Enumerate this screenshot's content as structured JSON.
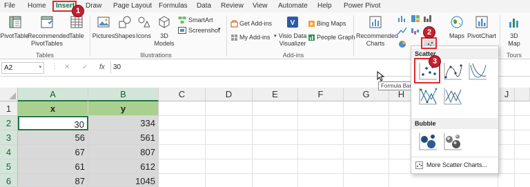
{
  "menu": {
    "items": [
      "File",
      "Home",
      "Insert",
      "Draw",
      "Page Layout",
      "Formulas",
      "Data",
      "Review",
      "View",
      "Automate",
      "Help",
      "Power Pivot"
    ],
    "active": "Insert"
  },
  "ribbon": {
    "tables": {
      "pivottable": "PivotTable",
      "recommended_line1": "Recommended",
      "recommended_line2": "PivotTables",
      "table": "Table",
      "group": "Tables"
    },
    "illustrations": {
      "pictures": "Pictures",
      "shapes": "Shapes",
      "icons": "Icons",
      "models_line1": "3D",
      "models_line2": "Models",
      "smartart": "SmartArt",
      "screenshot": "Screenshot",
      "group": "Illustrations"
    },
    "addins": {
      "get_addins": "Get Add-ins",
      "my_addins": "My Add-ins",
      "visio_line1": "Visio Data",
      "visio_line2": "Visualizer",
      "bing_maps": "Bing Maps",
      "people_graph": "People Graph",
      "group": "Add-ins"
    },
    "charts": {
      "recommended_line1": "Recommended",
      "recommended_line2": "Charts",
      "maps": "Maps",
      "pivotchart": "PivotChart"
    },
    "tours": {
      "map_line1": "3D",
      "map_line2": "Map",
      "group": "Tours"
    }
  },
  "formula_bar": {
    "name_box": "A2",
    "cancel": "✕",
    "enter": "✓",
    "fx": "fx",
    "value": "30"
  },
  "tooltip": "Formula Bar",
  "grid": {
    "columns": [
      "A",
      "B",
      "C",
      "D",
      "E",
      "F",
      "G",
      "H",
      "I",
      "J"
    ],
    "rows": [
      "1",
      "2",
      "3",
      "4",
      "5",
      "6"
    ],
    "header": [
      "x",
      "y"
    ],
    "data": [
      [
        "30",
        "334"
      ],
      [
        "56",
        "561"
      ],
      [
        "67",
        "807"
      ],
      [
        "61",
        "612"
      ],
      [
        "87",
        "1045"
      ]
    ]
  },
  "scatter_menu": {
    "scatter_heading": "Scatter",
    "bubble_heading": "Bubble",
    "more": "More Scatter Charts..."
  },
  "callouts": [
    "1",
    "2",
    "3"
  ],
  "colors": {
    "excel_green": "#107c41",
    "header_fill": "#a9d08e",
    "data_fill": "#d9d9d9",
    "callout_red": "#e0262d"
  }
}
